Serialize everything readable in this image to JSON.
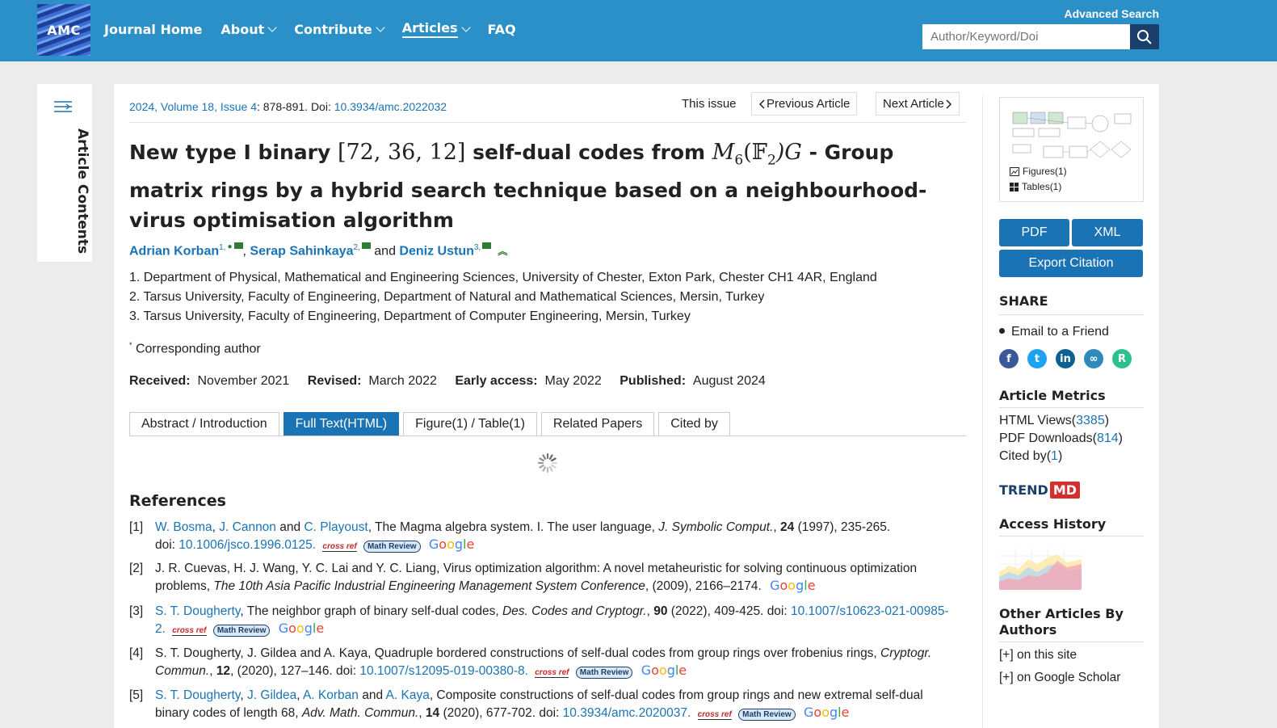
{
  "header": {
    "logo_text": "AMC",
    "nav": [
      {
        "label": "Journal Home",
        "dropdown": false,
        "active": false
      },
      {
        "label": "About",
        "dropdown": true,
        "active": false
      },
      {
        "label": "Contribute",
        "dropdown": true,
        "active": false
      },
      {
        "label": "Articles",
        "dropdown": true,
        "active": true
      },
      {
        "label": "FAQ",
        "dropdown": false,
        "active": false
      }
    ],
    "advanced_search": "Advanced Search",
    "search_placeholder": "Author/Keyword/Doi",
    "colors": {
      "bar": "#2b8fc8",
      "search_button": "#1a3f6a"
    }
  },
  "side_tab": {
    "label": "Article Contents",
    "icon": "menu-lines-icon"
  },
  "article": {
    "volume_link": "2024, Volume 18, Issue 4",
    "pages": ": 878-891. Doi: ",
    "doi": "10.3934/amc.2022032",
    "this_issue": "This issue",
    "previous": "Previous Article",
    "next": "Next Article",
    "title_part1": "New type I binary ",
    "title_math1": "[72, 36, 12]",
    "title_part2": " self-dual codes from ",
    "title_math2_M": "M",
    "title_math2_sub": "6",
    "title_math2_rest": "(𝔽",
    "title_math2_sub2": "2",
    "title_math2_end": ")G",
    "title_part3": " - Group matrix rings by a hybrid search technique based on a neighbourhood-virus optimisation algorithm",
    "authors": [
      {
        "name": "Adrian Korban",
        "sup": "1,"
      },
      {
        "name": "Serap Sahinkaya",
        "sup": "2,"
      },
      {
        "name": "Deniz Ustun",
        "sup": "3,"
      }
    ],
    "authors_sep1": ", ",
    "authors_sep2": " and ",
    "affiliations": [
      "1. Department of Physical, Mathematical and Engineering Sciences, University of Chester, Exton Park, Chester CH1 4AR, England",
      "2. Tarsus University, Faculty of Engineering, Department of Natural and Mathematical Sciences, Mersin, Turkey",
      "3. Tarsus University, Faculty of Engineering, Department of Computer Engineering, Mersin, Turkey"
    ],
    "corresponding_mark": "*",
    "corresponding": " Corresponding author",
    "dates": [
      {
        "label": "Received:",
        "value": "November 2021"
      },
      {
        "label": "Revised:",
        "value": "March 2022"
      },
      {
        "label": "Early access:",
        "value": "May 2022"
      },
      {
        "label": "Published:",
        "value": "August 2024"
      }
    ],
    "tabs": [
      "Abstract / Introduction",
      "Full Text(HTML)",
      "Figure(1) / Table(1)",
      "Related Papers",
      "Cited by"
    ],
    "active_tab": "Full Text(HTML)"
  },
  "references": {
    "heading": "References",
    "badges": {
      "crossref": "cross ref",
      "math_review": "Math Review",
      "google": [
        "G",
        "o",
        "o",
        "g",
        "l",
        "e"
      ]
    },
    "items": [
      {
        "num": "[1]",
        "authors": [
          "W. Bosma",
          "J. Cannon",
          "C. Playoust"
        ],
        "text": ", The Magma algebra system. I. The user language, ",
        "journal": "J. Symbolic Comput.",
        "vol": "24",
        "rest": " (1997), 235-265.",
        "doi_label": "doi: ",
        "doi": "10.1006/jsco.1996.0125."
      },
      {
        "num": "[2]",
        "text": "J. R. Cuevas, H. J. Wang, Y. C. Lai and Y. C. Liang, Virus optimization algorithm: A novel metaheuristic for solving continuous optimization problems, ",
        "journal": "The 10th Asia Pacific Industrial Engineering Management System Conference",
        "rest": ", (2009), 2166–2174."
      },
      {
        "num": "[3]",
        "authors": [
          "S. T. Dougherty"
        ],
        "text": ", The neighbor graph of binary self-dual codes, ",
        "journal": "Des. Codes and Cryptogr.",
        "vol": "90",
        "rest": " (2022), 409-425.  doi: ",
        "doi": "10.1007/s10623-021-00985-2."
      },
      {
        "num": "[4]",
        "text": "S. T. Dougherty, J. Gildea and A. Kaya, Quadruple bordered constructions of self-dual codes from group rings over frobenius rings, ",
        "journal": "Cryptogr. Commun.",
        "vol": "12",
        "rest": ", (2020), 127–146. doi: ",
        "doi": "10.1007/s12095-019-00380-8."
      },
      {
        "num": "[5]",
        "authors": [
          "S. T. Dougherty",
          "J. Gildea",
          "A. Korban",
          "A. Kaya"
        ],
        "text": ", Composite constructions of self-dual codes from group rings and new extremal self-dual binary codes of length 68, ",
        "journal": "Adv. Math. Commun.",
        "vol": "14",
        "rest": " (2020), 677-702.  doi: ",
        "doi": "10.3934/amc.2020037."
      }
    ]
  },
  "sidebar": {
    "figures_label": "Figures(1)",
    "tables_label": "Tables(1)",
    "pdf": "PDF",
    "xml": "XML",
    "export": "Export Citation",
    "share_heading": "SHARE",
    "email_friend": "Email to a Friend",
    "social": [
      "facebook-icon",
      "twitter-icon",
      "linkedin-icon",
      "mendeley-icon",
      "researchgate-icon"
    ],
    "metrics_heading": "Article Metrics",
    "html_views_label": "HTML Views(",
    "html_views": "3385",
    "pdf_downloads_label": "PDF Downloads(",
    "pdf_downloads": "814",
    "cited_by_label": "Cited by(",
    "cited_by": "1",
    "close_paren": ")",
    "trend_part1": "TREND",
    "trend_part2": "MD",
    "access_history": "Access History",
    "other_articles": "Other Articles By Authors",
    "on_this_site": "[+] on this site",
    "on_google_scholar": "[+] on Google Scholar",
    "colors": {
      "button": "#1a73b5",
      "link": "#1a73b5"
    }
  }
}
